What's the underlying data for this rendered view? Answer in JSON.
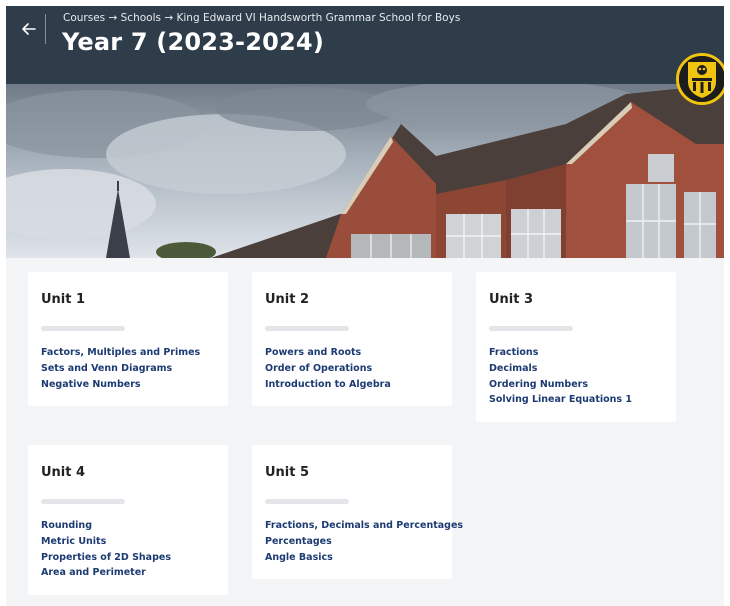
{
  "header": {
    "breadcrumb": [
      "Courses",
      "Schools",
      "King Edward VI Handsworth Grammar School for Boys"
    ],
    "separator": "→",
    "title": "Year 7 (2023-2024)"
  },
  "icons": {
    "back": "arrow-left-icon",
    "logo": "school-crest-logo"
  },
  "colors": {
    "header_bg": "#2f3d4b",
    "link": "#1d3b72",
    "page_bg": "#f4f5f7",
    "card_bg": "#ffffff"
  },
  "units": [
    {
      "title": "Unit 1",
      "topics": [
        "Factors, Multiples and Primes",
        "Sets and Venn Diagrams",
        "Negative Numbers"
      ]
    },
    {
      "title": "Unit 2",
      "topics": [
        "Powers and Roots",
        "Order of Operations",
        "Introduction to Algebra"
      ]
    },
    {
      "title": "Unit 3",
      "topics": [
        "Fractions",
        "Decimals",
        "Ordering Numbers",
        "Solving Linear Equations 1"
      ]
    },
    {
      "title": "Unit 4",
      "topics": [
        "Rounding",
        "Metric Units",
        "Properties of 2D Shapes",
        "Area and Perimeter"
      ]
    },
    {
      "title": "Unit 5",
      "topics": [
        "Fractions, Decimals and Percentages",
        "Percentages",
        "Angle Basics"
      ]
    }
  ]
}
